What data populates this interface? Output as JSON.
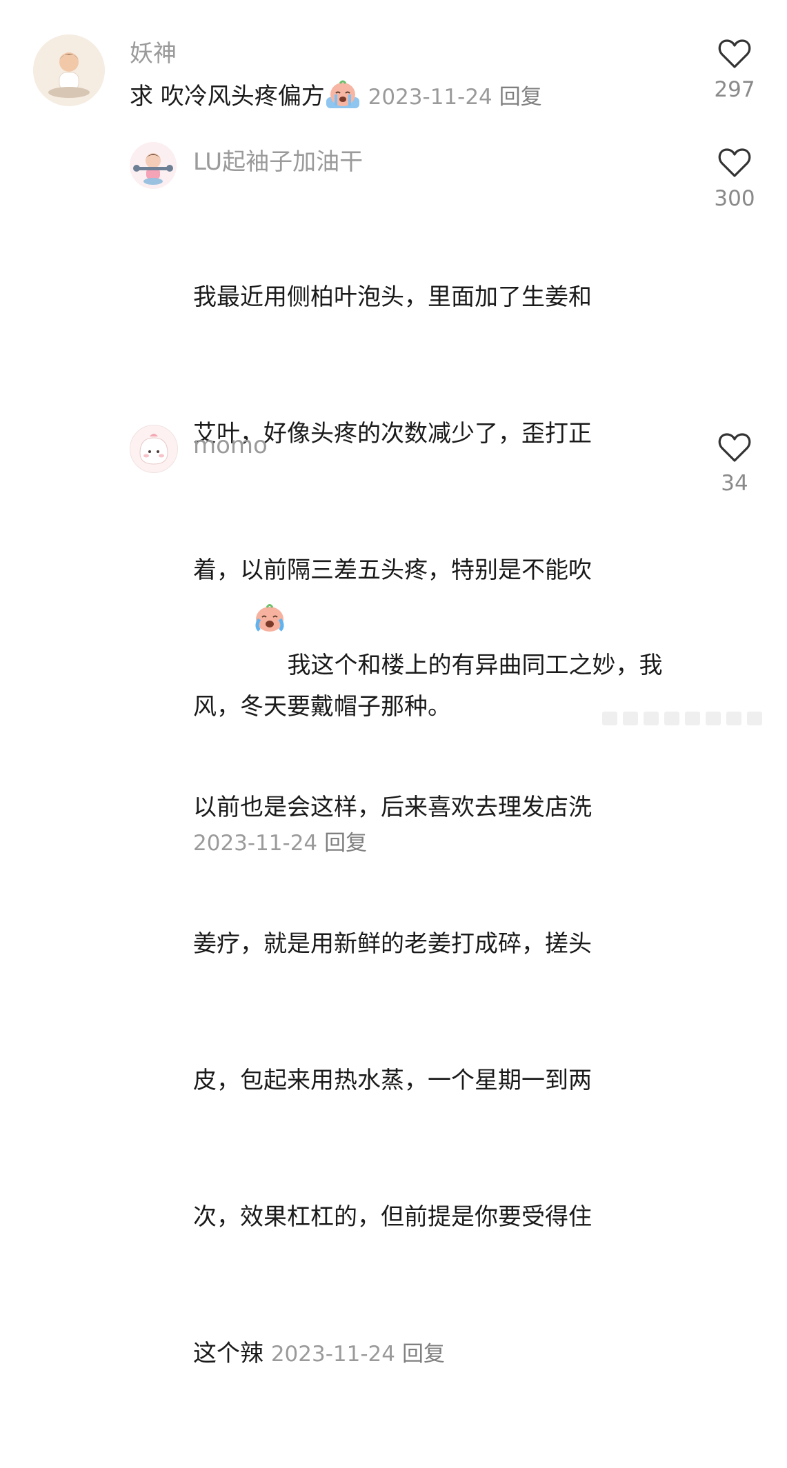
{
  "comments": [
    {
      "username": "妖神",
      "text": "求 吹冷风头疼偏方",
      "emoji": "crying-peach-emoji",
      "date": "2023-11-24",
      "reply": "回复",
      "likes": "297"
    },
    {
      "username": "LU起袖子加油干",
      "lines": [
        "我最近用侧柏叶泡头，里面加了生姜和",
        "艾叶，好像头疼的次数减少了，歪打正",
        "着，以前隔三差五头疼，特别是不能吹",
        "风，冬天要戴帽子那种。"
      ],
      "date": "2023-11-24",
      "reply": "回复",
      "likes": "300"
    },
    {
      "username": "momo",
      "emoji": "crying-peach-emoji",
      "lines": [
        "我这个和楼上的有异曲同工之妙，我",
        "以前也是会这样，后来喜欢去理发店洗",
        "姜疗，就是用新鲜的老姜打成碎，搓头",
        "皮，包起来用热水蒸，一个星期一到两",
        "次，效果杠杠的，但前提是你要受得住",
        "这个辣"
      ],
      "date": "2023-11-24",
      "reply": "回复",
      "likes": "34"
    }
  ],
  "colors": {
    "text": "#1a1a1a",
    "meta": "#9a9a9a",
    "heart_stroke": "#333333"
  }
}
